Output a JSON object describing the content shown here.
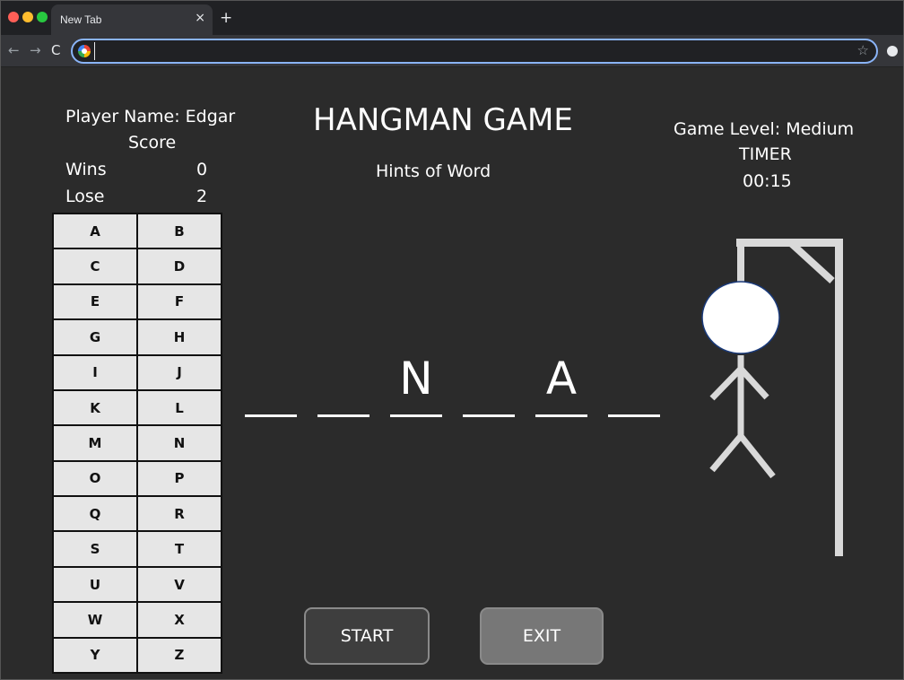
{
  "browser": {
    "tab_title": "New Tab",
    "tab_close": "×",
    "new_tab": "+",
    "nav_back": "←",
    "nav_forward": "→",
    "nav_reload": "C",
    "url_value": "",
    "star": "☆"
  },
  "game": {
    "player_name": "Player Name: Edgar",
    "score_label": "Score",
    "wins_label": "Wins",
    "wins_value": "0",
    "lose_label": "Lose",
    "lose_value": "2",
    "title": "HANGMAN GAME",
    "hints_label": "Hints of Word",
    "level": "Game Level: Medium",
    "timer_label": "TIMER",
    "timer_value": "00:15",
    "letters": [
      "A",
      "B",
      "C",
      "D",
      "E",
      "F",
      "G",
      "H",
      "I",
      "J",
      "K",
      "L",
      "M",
      "N",
      "O",
      "P",
      "Q",
      "R",
      "S",
      "T",
      "U",
      "V",
      "W",
      "X",
      "Y",
      "Z"
    ],
    "word_slots": [
      "",
      "",
      "N",
      "",
      "A",
      ""
    ],
    "start_label": "START",
    "exit_label": "EXIT"
  },
  "colors": {
    "background": "#2b2b2b",
    "key_background": "#e6e6e6",
    "gallows": "#d9d9d9",
    "head": "#ffffff",
    "start_button": "#3e3e3e",
    "exit_button": "#777777"
  }
}
